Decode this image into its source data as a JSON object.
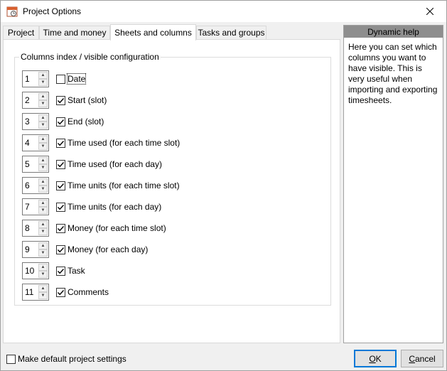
{
  "window": {
    "title": "Project Options"
  },
  "tabs": [
    {
      "label": "Project"
    },
    {
      "label": "Time and money"
    },
    {
      "label": "Sheets and columns"
    },
    {
      "label": "Tasks and groups"
    }
  ],
  "columns_group": {
    "title": "Columns index / visible configuration",
    "rows": [
      {
        "index": "1",
        "checked": false,
        "label": "Date"
      },
      {
        "index": "2",
        "checked": true,
        "label": "Start (slot)"
      },
      {
        "index": "3",
        "checked": true,
        "label": "End (slot)"
      },
      {
        "index": "4",
        "checked": true,
        "label": "Time used (for each time slot)"
      },
      {
        "index": "5",
        "checked": true,
        "label": "Time used (for each day)"
      },
      {
        "index": "6",
        "checked": true,
        "label": "Time units (for each time slot)"
      },
      {
        "index": "7",
        "checked": true,
        "label": "Time units (for each day)"
      },
      {
        "index": "8",
        "checked": true,
        "label": "Money (for each time slot)"
      },
      {
        "index": "9",
        "checked": true,
        "label": "Money (for each day)"
      },
      {
        "index": "10",
        "checked": true,
        "label": "Task"
      },
      {
        "index": "11",
        "checked": true,
        "label": "Comments"
      }
    ]
  },
  "help": {
    "title": "Dynamic help",
    "text": "Here you can set which columns you want to have visible. This is very useful when importing and exporting timesheets."
  },
  "footer": {
    "default_settings_label": "Make default project settings",
    "default_settings_checked": false,
    "ok_label": "OK",
    "cancel_label": "Cancel"
  },
  "colors": {
    "accent": "#0078d7",
    "help_header_bg": "#8e8e8e"
  }
}
